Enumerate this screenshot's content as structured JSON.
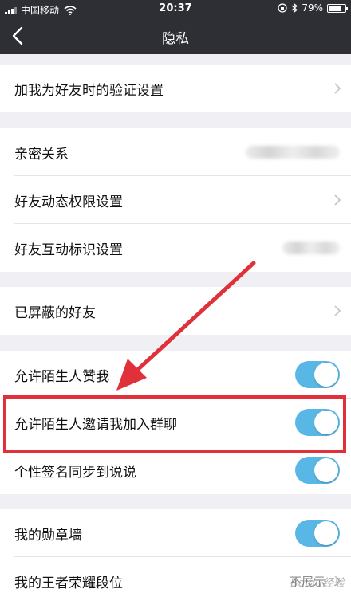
{
  "status_bar": {
    "carrier": "中国移动",
    "time": "20:37",
    "battery": "79%",
    "battery_level": 0.79
  },
  "navbar": {
    "title": "隐私",
    "back_icon": "chevron-left-icon"
  },
  "rows": {
    "verify": {
      "label": "加我为好友时的验证设置"
    },
    "intimate": {
      "label": "亲密关系"
    },
    "moments_permission": {
      "label": "好友动态权限设置"
    },
    "interaction_marks": {
      "label": "好友互动标识设置"
    },
    "blocked": {
      "label": "已屏蔽的好友"
    },
    "stranger_like": {
      "label": "允许陌生人赞我",
      "enabled": true
    },
    "stranger_invite": {
      "label": "允许陌生人邀请我加入群聊",
      "enabled": true
    },
    "signature_sync": {
      "label": "个性签名同步到说说",
      "enabled": true
    },
    "badge_wall": {
      "label": "我的勋章墙",
      "enabled": true
    },
    "honor_rank": {
      "label": "我的王者荣耀段位",
      "value": "不展示"
    }
  },
  "colors": {
    "toggle_on": "#59b7e6",
    "navbar": "#2e2f34",
    "annotation": "#e0303a"
  },
  "watermark": "Baidu经验"
}
